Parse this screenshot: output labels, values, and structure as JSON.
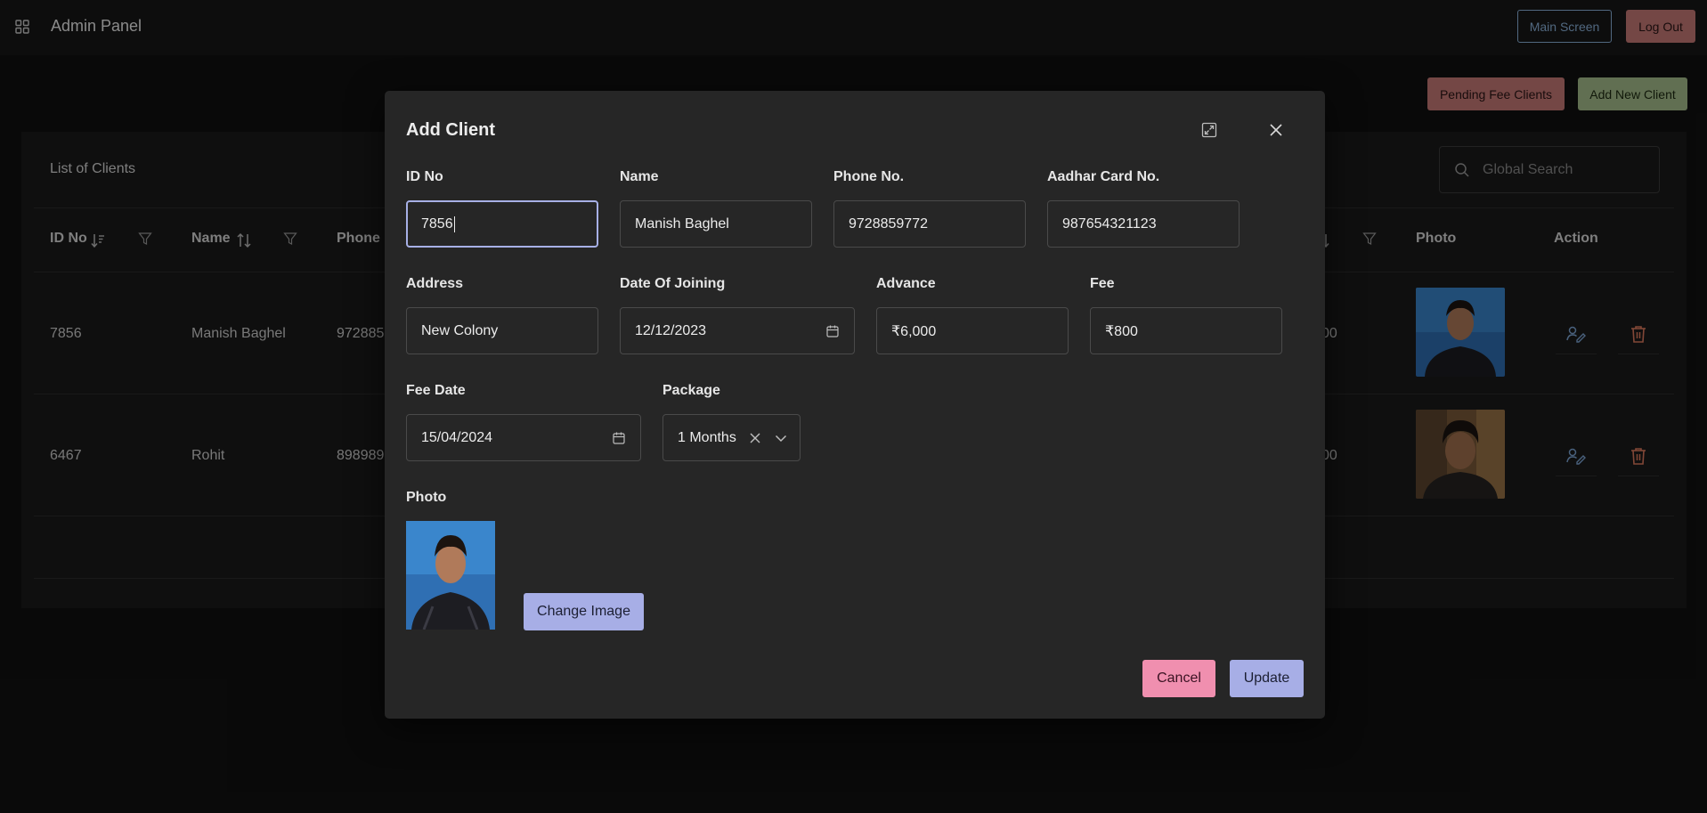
{
  "topbar": {
    "title": "Admin Panel",
    "main_screen_label": "Main Screen",
    "logout_label": "Log Out"
  },
  "actions": {
    "pending_label": "Pending Fee Clients",
    "add_label": "Add New Client"
  },
  "table": {
    "title": "List of Clients",
    "search_placeholder": "Global Search",
    "columns": {
      "id": "ID No",
      "name": "Name",
      "phone": "Phone N",
      "photo": "Photo",
      "action": "Action"
    },
    "rows": [
      {
        "id": "7856",
        "name": "Manish Baghel",
        "phone": "972885",
        "fee_tail": "00"
      },
      {
        "id": "6467",
        "name": "Rohit",
        "phone": "898989",
        "fee_tail": "00"
      }
    ]
  },
  "dialog": {
    "title": "Add Client",
    "fields": {
      "id_label": "ID No",
      "id_value": "7856",
      "name_label": "Name",
      "name_value": "Manish Baghel",
      "phone_label": "Phone No.",
      "phone_value": "9728859772",
      "aadhar_label": "Aadhar Card No.",
      "aadhar_value": "987654321123",
      "address_label": "Address",
      "address_value": "New Colony",
      "doj_label": "Date Of Joining",
      "doj_value": "12/12/2023",
      "advance_label": "Advance",
      "advance_value": "₹6,000",
      "fee_label": "Fee",
      "fee_value": "₹800",
      "fee_date_label": "Fee Date",
      "fee_date_value": "15/04/2024",
      "package_label": "Package",
      "package_value": "1 Months",
      "photo_label": "Photo"
    },
    "change_image_label": "Change Image",
    "cancel_label": "Cancel",
    "update_label": "Update"
  },
  "colors": {
    "accent": "#a7aee6",
    "danger": "#c87a78",
    "success": "#a7c08d",
    "cancel": "#f08faf",
    "link_blue": "#8cb4dc",
    "delete_icon": "#e07a5f"
  },
  "icons": [
    "grid-icon",
    "search-icon",
    "sort-desc-icon",
    "sort-icon",
    "filter-icon",
    "edit-user-icon",
    "trash-icon",
    "expand-icon",
    "close-icon",
    "calendar-icon",
    "clear-icon",
    "chevron-down-icon"
  ]
}
